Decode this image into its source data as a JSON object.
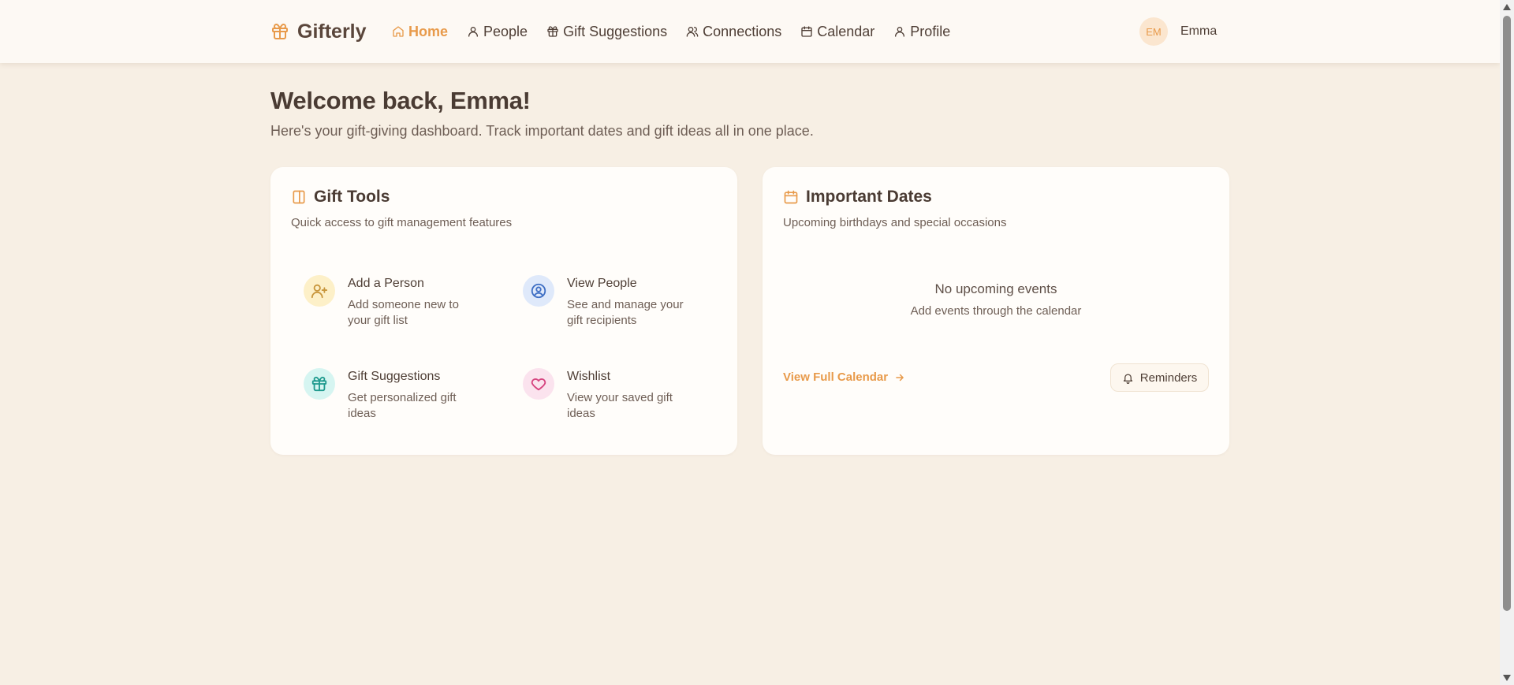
{
  "app": {
    "name": "Gifterly",
    "brand_color": "#e89a4a"
  },
  "nav": {
    "items": [
      {
        "label": "Home",
        "icon": "home-icon",
        "active": true
      },
      {
        "label": "People",
        "icon": "person-icon"
      },
      {
        "label": "Gift Suggestions",
        "icon": "gift-icon"
      },
      {
        "label": "Connections",
        "icon": "users-icon"
      },
      {
        "label": "Calendar",
        "icon": "calendar-icon"
      },
      {
        "label": "Profile",
        "icon": "user-icon"
      }
    ]
  },
  "user": {
    "initials": "EM",
    "name": "Emma"
  },
  "welcome": {
    "title": "Welcome back, Emma!",
    "subtitle": "Here's your gift-giving dashboard. Track important dates and gift ideas all in one place."
  },
  "gift_tools": {
    "title": "Gift Tools",
    "subtitle": "Quick access to gift management features",
    "items": [
      {
        "title": "Add a Person",
        "desc": "Add someone new to your gift list",
        "icon": "user-plus-icon",
        "color": "#c8963c",
        "bg": "#fdf0c8"
      },
      {
        "title": "View People",
        "desc": "See and manage your gift recipients",
        "icon": "user-circle-icon",
        "color": "#3f6fc4",
        "bg": "#dfe9fa"
      },
      {
        "title": "Gift Suggestions",
        "desc": "Get personalized gift ideas",
        "icon": "gift-icon",
        "color": "#1f9a8e",
        "bg": "#d6f5f1"
      },
      {
        "title": "Wishlist",
        "desc": "View your saved gift ideas",
        "icon": "heart-icon",
        "color": "#d6437f",
        "bg": "#fbe3ee"
      }
    ]
  },
  "important_dates": {
    "title": "Important Dates",
    "subtitle": "Upcoming birthdays and special occasions",
    "empty_title": "No upcoming events",
    "empty_sub": "Add events through the calendar",
    "calendar_link": "View Full Calendar",
    "reminders_label": "Reminders"
  }
}
